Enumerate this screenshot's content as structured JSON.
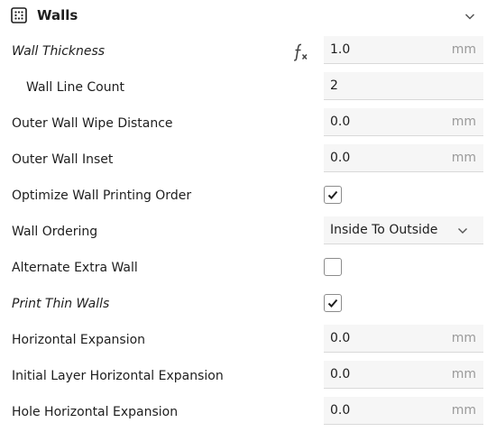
{
  "section": {
    "title": "Walls",
    "icon": "walls-grid-icon",
    "collapse_icon": "chevron-down-icon"
  },
  "settings": [
    {
      "label": "Wall Thickness",
      "value": "1.0",
      "unit": "mm",
      "italic": true,
      "has_formula": true
    },
    {
      "label": "Wall Line Count",
      "value": "2",
      "unit": "",
      "indented": true
    },
    {
      "label": "Outer Wall Wipe Distance",
      "value": "0.0",
      "unit": "mm"
    },
    {
      "label": "Outer Wall Inset",
      "value": "0.0",
      "unit": "mm"
    },
    {
      "label": "Optimize Wall Printing Order",
      "checked": true
    },
    {
      "label": "Wall Ordering",
      "selected": "Inside To Outside"
    },
    {
      "label": "Alternate Extra Wall",
      "checked": false
    },
    {
      "label": "Print Thin Walls",
      "checked": true,
      "italic": true
    },
    {
      "label": "Horizontal Expansion",
      "value": "0.0",
      "unit": "mm"
    },
    {
      "label": "Initial Layer Horizontal Expansion",
      "value": "0.0",
      "unit": "mm"
    },
    {
      "label": "Hole Horizontal Expansion",
      "value": "0.0",
      "unit": "mm"
    }
  ]
}
